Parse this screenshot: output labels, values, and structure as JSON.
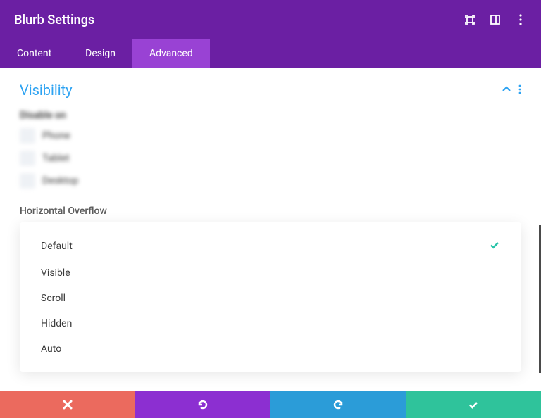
{
  "header": {
    "title": "Blurb Settings"
  },
  "tabs": {
    "content": "Content",
    "design": "Design",
    "advanced": "Advanced"
  },
  "section": {
    "title": "Visibility"
  },
  "disable": {
    "label": "Disable on",
    "phone": "Phone",
    "tablet": "Tablet",
    "desktop": "Desktop"
  },
  "overflow": {
    "label": "Horizontal Overflow",
    "options": {
      "default": "Default",
      "visible": "Visible",
      "scroll": "Scroll",
      "hidden": "Hidden",
      "auto": "Auto"
    }
  }
}
